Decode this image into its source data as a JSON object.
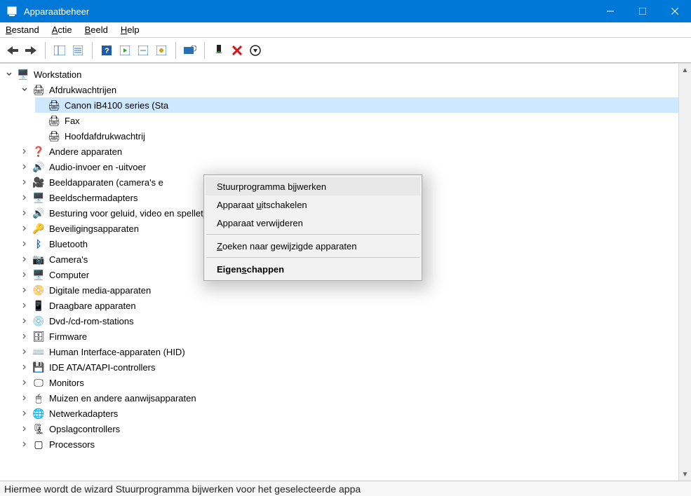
{
  "window": {
    "title": "Apparaatbeheer"
  },
  "menubar": {
    "file": "Bestand",
    "action": "Actie",
    "view": "Beeld",
    "help": "Help"
  },
  "tree": {
    "root": "Workstation",
    "printqueues": {
      "label": "Afdrukwachtrijen",
      "children": [
        {
          "label": "Canon iB4100 series (Sta"
        },
        {
          "label": "Fax"
        },
        {
          "label": "Hoofdafdrukwachtrij"
        }
      ]
    },
    "categories": [
      {
        "icon": "other",
        "label": "Andere apparaten"
      },
      {
        "icon": "audio",
        "label": "Audio-invoer en -uitvoer"
      },
      {
        "icon": "camera",
        "label": "Beeldapparaten (camera's e"
      },
      {
        "icon": "display",
        "label": "Beeldschermadapters"
      },
      {
        "icon": "audio",
        "label": "Besturing voor geluid, video en spelletjes"
      },
      {
        "icon": "security",
        "label": "Beveiligingsapparaten"
      },
      {
        "icon": "bluetooth",
        "label": "Bluetooth"
      },
      {
        "icon": "camera2",
        "label": "Camera's"
      },
      {
        "icon": "computer",
        "label": "Computer"
      },
      {
        "icon": "media",
        "label": "Digitale media-apparaten"
      },
      {
        "icon": "portable",
        "label": "Draagbare apparaten"
      },
      {
        "icon": "disc",
        "label": "Dvd-/cd-rom-stations"
      },
      {
        "icon": "firmware",
        "label": "Firmware"
      },
      {
        "icon": "hid",
        "label": "Human Interface-apparaten (HID)"
      },
      {
        "icon": "ide",
        "label": "IDE ATA/ATAPI-controllers"
      },
      {
        "icon": "monitor",
        "label": "Monitors"
      },
      {
        "icon": "mouse",
        "label": "Muizen en andere aanwijsapparaten"
      },
      {
        "icon": "network",
        "label": "Netwerkadapters"
      },
      {
        "icon": "storage",
        "label": "Opslagcontrollers"
      },
      {
        "icon": "cpu",
        "label": "Processors"
      }
    ]
  },
  "context_menu": {
    "items": [
      {
        "label": "Stuurprogramma bijwerken",
        "u": 16,
        "highlight": true
      },
      {
        "label": "Apparaat uitschakelen",
        "u": 9
      },
      {
        "label": "Apparaat verwijderen",
        "u": 14
      },
      {
        "sep": true
      },
      {
        "label": "Zoeken naar gewijzigde apparaten",
        "u": 0
      },
      {
        "sep": true
      },
      {
        "label": "Eigenschappen",
        "u": 5,
        "bold": true
      }
    ]
  },
  "statusbar": {
    "text": "Hiermee wordt de wizard Stuurprogramma bijwerken voor het geselecteerde appa"
  },
  "icons": {
    "computer": "🖥️",
    "printqueue": "🖨",
    "printer": "🖨",
    "other": "❓",
    "audio": "🔊",
    "camera": "🎥",
    "display": "🖥️",
    "security": "🔑",
    "bluetooth": "ᛒ",
    "camera2": "📷",
    "media": "📀",
    "portable": "📱",
    "disc": "💿",
    "firmware": "🗄",
    "hid": "⌨️",
    "ide": "💾",
    "monitor": "🖵",
    "mouse": "🖱",
    "network": "🌐",
    "storage": "🗜",
    "cpu": "▢"
  }
}
